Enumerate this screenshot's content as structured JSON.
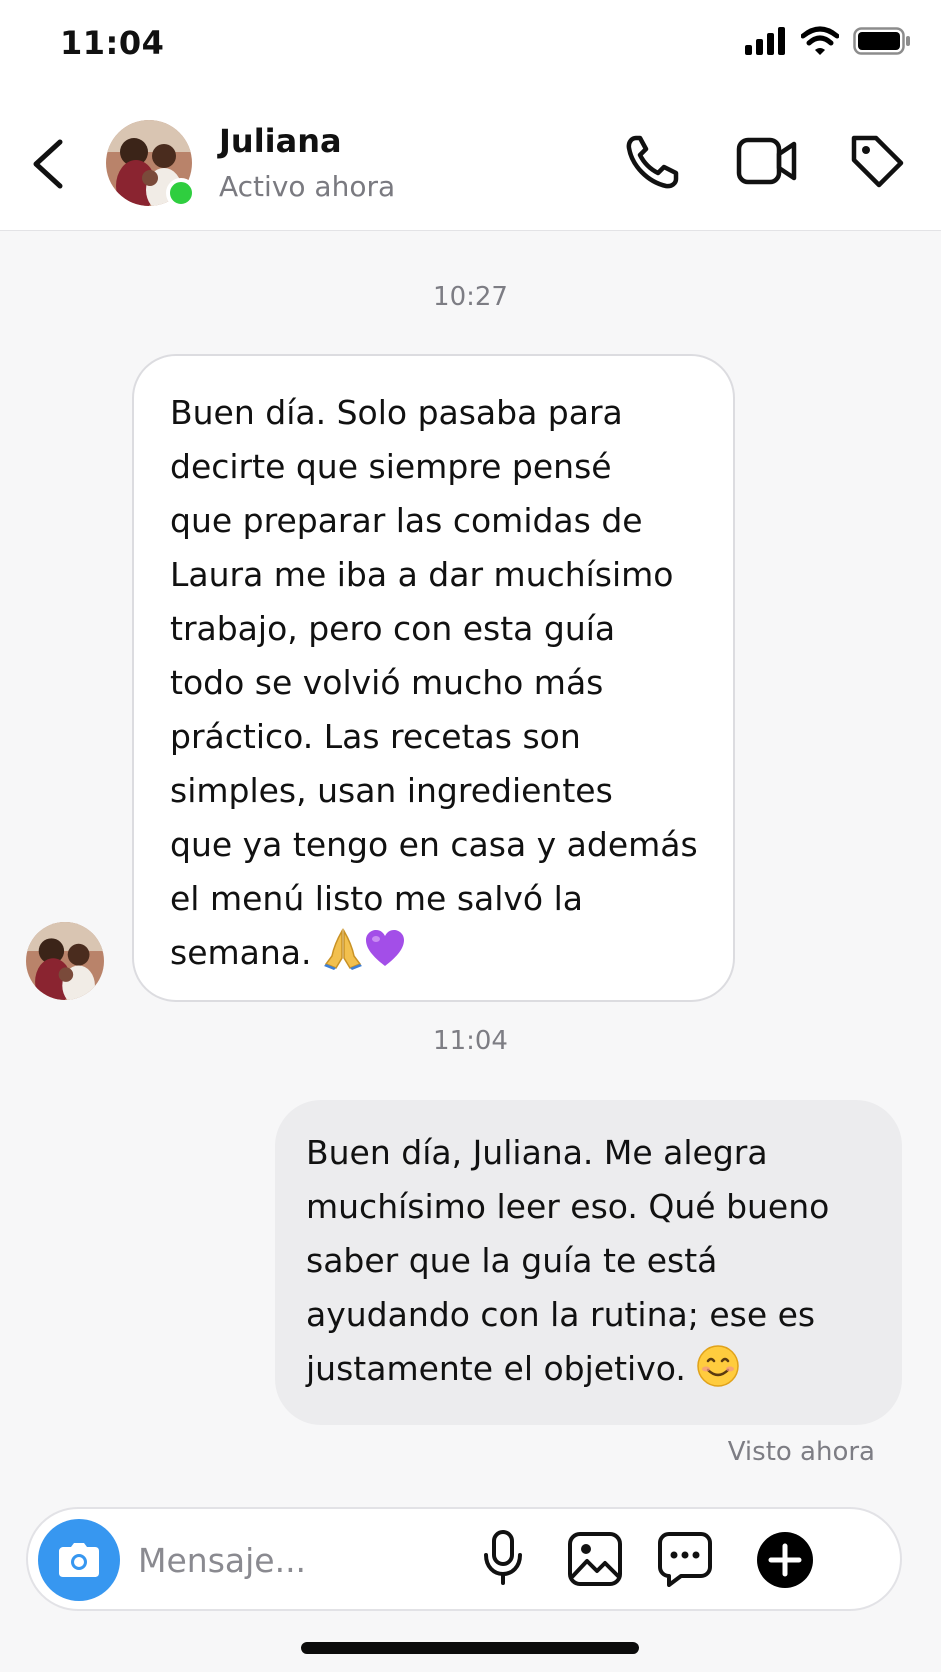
{
  "status_bar": {
    "time": "11:04"
  },
  "header": {
    "contact_name": "Juliana",
    "contact_status": "Activo ahora",
    "online_color": "#2fce3f"
  },
  "conversation": {
    "timestamp_1": "10:27",
    "incoming_message": "Buen día. Solo pasaba para\ndecirte que siempre pensé\nque preparar las comidas de\nLaura me iba a dar muchísimo\ntrabajo, pero con esta guía\ntodo se volvió mucho más\npráctico. Las recetas son\nsimples, usan ingredientes\nque ya tengo en casa y además\nel menú listo me salvó la\nsemana.",
    "incoming_emoji_1": "folded-hands",
    "incoming_emoji_2": "purple-heart",
    "timestamp_2": "11:04",
    "outgoing_message": "Buen día, Juliana. Me alegra\nmuchísimo leer eso. Qué bueno\nsaber que la guía te está\nayudando con la rutina; ese es\njustamente el objetivo.",
    "outgoing_emoji": "smiling-face",
    "seen_label": "Visto ahora"
  },
  "composer": {
    "placeholder": "Mensaje...",
    "camera_color": "#3797f0"
  },
  "icons": {
    "back": "chevron-left-icon",
    "call": "phone-icon",
    "video": "video-camera-icon",
    "tag": "tag-icon",
    "camera": "camera-icon",
    "mic": "microphone-icon",
    "gallery": "image-icon",
    "sticker": "chat-bubble-icon",
    "add": "plus-circle-icon"
  }
}
